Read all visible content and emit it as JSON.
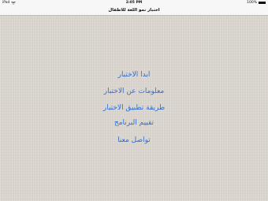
{
  "status_bar": {
    "carrier": "iPad",
    "time": "2:05 PM",
    "battery_percent": "100%",
    "wifi_icon": "wifi-icon",
    "battery_icon": "battery-icon",
    "battery_level": 1.0
  },
  "nav": {
    "title": "اختبار نمو اللغة للاطفال"
  },
  "menu": {
    "items": [
      {
        "label": "ابدا الاختبار"
      },
      {
        "label": "معلومات عن الاختبار"
      },
      {
        "label": "طريقة تطبيق الاختبار"
      },
      {
        "label": "تقييم البرنامج"
      },
      {
        "label": "تواصل معنا"
      }
    ]
  },
  "colors": {
    "background": "#ddd8d0",
    "link": "#2f6fd6",
    "bar": "#f7f7f7"
  }
}
